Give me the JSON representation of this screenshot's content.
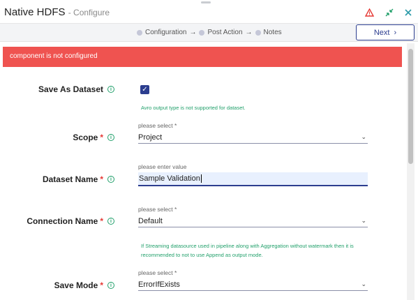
{
  "header": {
    "title": "Native HDFS",
    "subtitle": "- Configure",
    "icons": [
      "warning-icon",
      "collapse-icon",
      "close-icon"
    ]
  },
  "stepper": {
    "steps": [
      "Configuration",
      "Post Action",
      "Notes"
    ],
    "next_label": "Next"
  },
  "alert": {
    "message": "component is not configured",
    "color": "#ef5350"
  },
  "form": {
    "save_as_dataset": {
      "label": "Save As Dataset",
      "checked": true,
      "note": "Avro output type is not supported for dataset."
    },
    "scope": {
      "label": "Scope",
      "hint": "please select *",
      "value": "Project"
    },
    "dataset_name": {
      "label": "Dataset Name",
      "hint": "please enter value",
      "value": "Sample Validation"
    },
    "connection_name": {
      "label": "Connection Name",
      "hint": "please select *",
      "value": "Default",
      "note_line1": "If Streaming datasource used in pipeline along with Aggregation without watermark then it is",
      "note_line2": "recommended to not to use Append as output mode."
    },
    "save_mode": {
      "label": "Save Mode",
      "hint": "please select *",
      "value": "ErrorIfExists"
    }
  },
  "colors": {
    "primary": "#2c3e8f",
    "required": "#e53935",
    "info_green": "#22a06b"
  }
}
